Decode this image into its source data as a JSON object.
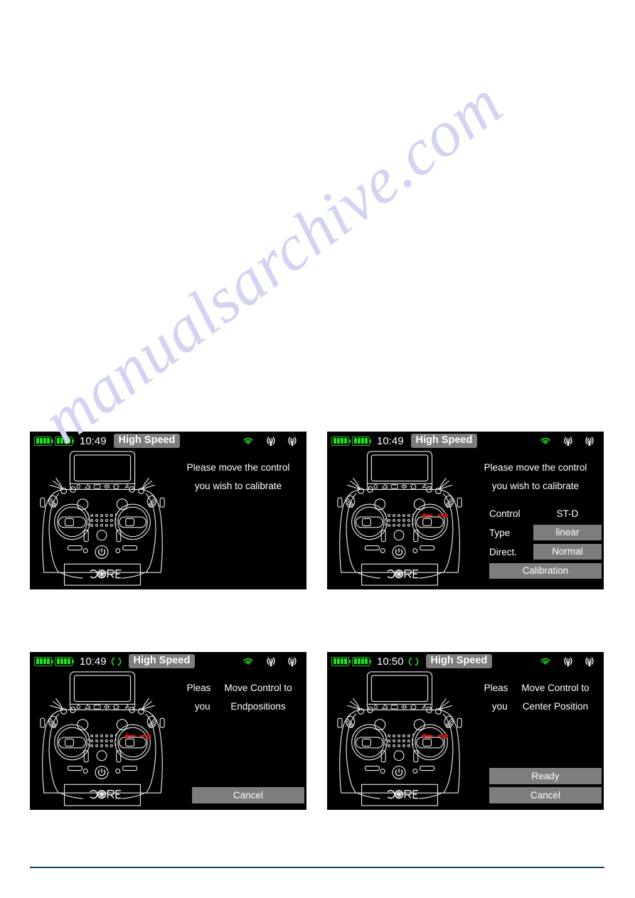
{
  "document": {
    "page_background": "#ffffff",
    "footer_rule_color": "#0b4a63",
    "watermark_text": "manualsarchive.com",
    "watermark_color": "#d3d3f2"
  },
  "colors": {
    "screen_background": "#000000",
    "battery_green": "#19c719",
    "wifi_green": "#22cc22",
    "sync_green": "#22cc22",
    "button_grey": "#7d7d7d",
    "text_white": "#ffffff",
    "arrow_red": "#cc1111",
    "outline_white": "#e8e8e8"
  },
  "figures": [
    {
      "id": "screen-1",
      "status_bar": {
        "battery_1_bars": 4,
        "battery_2_bars": 4,
        "time": "10:49",
        "sync_icon_visible": false,
        "mode_label": "High Speed",
        "wifi_icon": "wifi-icon",
        "antenna_icons": [
          "antenna-icon",
          "antenna-icon"
        ]
      },
      "prompt_lines": [
        "Please move the control",
        "you wish to calibrate"
      ],
      "overlay_lines": [],
      "settings": [],
      "wide_button": null,
      "action_buttons": [],
      "gimbal_arrows": false
    },
    {
      "id": "screen-2",
      "status_bar": {
        "battery_1_bars": 4,
        "battery_2_bars": 4,
        "time": "10:49",
        "sync_icon_visible": false,
        "mode_label": "High Speed",
        "wifi_icon": "wifi-icon",
        "antenna_icons": [
          "antenna-icon",
          "antenna-icon"
        ]
      },
      "prompt_lines": [
        "Please move the control",
        "you wish to calibrate"
      ],
      "overlay_lines": [],
      "settings": [
        {
          "label": "Control",
          "value": "ST-D",
          "style": "plain"
        },
        {
          "label": "Type",
          "value": "linear",
          "style": "button"
        },
        {
          "label": "Direct.",
          "value": "Normal",
          "style": "button"
        }
      ],
      "wide_button": "Calibration",
      "action_buttons": [],
      "gimbal_arrows": true
    },
    {
      "id": "screen-3",
      "status_bar": {
        "battery_1_bars": 4,
        "battery_2_bars": 4,
        "time": "10:49",
        "sync_icon_visible": true,
        "mode_label": "High Speed",
        "wifi_icon": "wifi-icon",
        "antenna_icons": [
          "antenna-icon",
          "antenna-icon"
        ]
      },
      "prompt_lines": [
        "Please move the control",
        "you wish to calibrate"
      ],
      "overlay_lines": [
        "Move Control to",
        "Endpositions"
      ],
      "settings": [],
      "wide_button": null,
      "action_buttons": [
        "Cancel"
      ],
      "gimbal_arrows": true
    },
    {
      "id": "screen-4",
      "status_bar": {
        "battery_1_bars": 4,
        "battery_2_bars": 4,
        "time": "10:50",
        "sync_icon_visible": true,
        "mode_label": "High Speed",
        "wifi_icon": "wifi-icon",
        "antenna_icons": [
          "antenna-icon",
          "antenna-icon"
        ]
      },
      "prompt_lines": [
        "Please move the control",
        "you wish to calibrate"
      ],
      "overlay_lines": [
        "Move Control to",
        "Center Position"
      ],
      "settings": [],
      "wide_button": null,
      "action_buttons": [
        "Ready",
        "Cancel"
      ],
      "gimbal_arrows": true
    }
  ],
  "transmitter": {
    "brand_text": "CORE",
    "bezel_icons": [
      "home-icon",
      "user-icon",
      "model-icon",
      "mute-icon",
      "antenna-small-icon",
      "trim-icon"
    ],
    "power_icon": "power-icon"
  }
}
